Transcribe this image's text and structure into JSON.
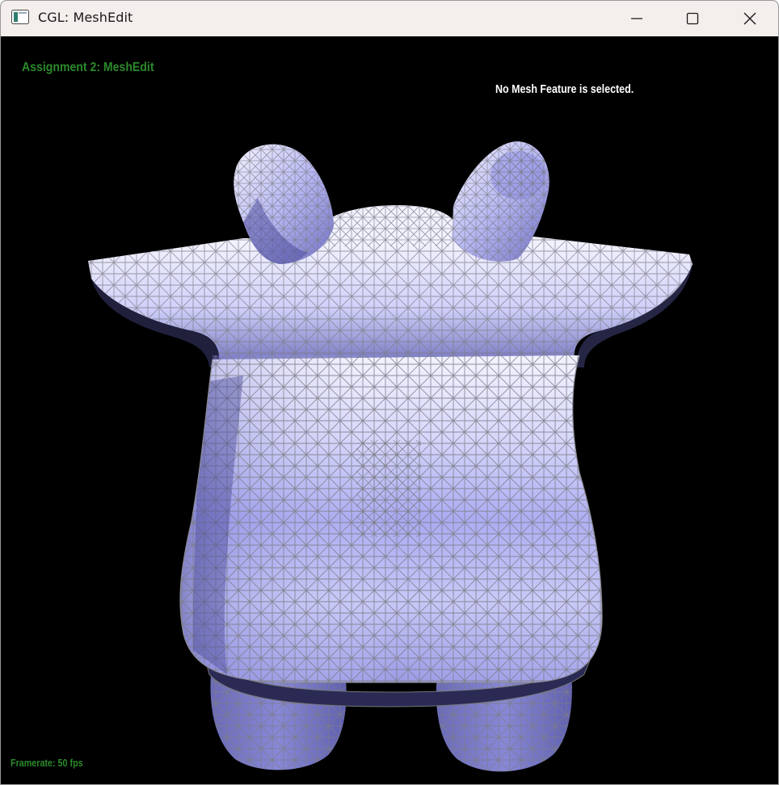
{
  "window": {
    "title": "CGL: MeshEdit",
    "controls": {
      "minimize": "minimize-icon",
      "maximize": "maximize-icon",
      "close": "close-icon"
    }
  },
  "viewport": {
    "assignment_title": "Assignment 2: MeshEdit",
    "selection_status": "No Mesh Feature is selected.",
    "framerate": "Framerate: 50 fps",
    "colors": {
      "hud_green": "#2b8a2b",
      "hud_white": "#ffffff",
      "mesh_fill_light": "#eeeeff",
      "mesh_fill_mid": "#b4b4f0",
      "mesh_fill_dark": "#5a5aa0",
      "mesh_wire": "#7a7a7a",
      "background": "#000000"
    },
    "model": "cow-mesh"
  }
}
